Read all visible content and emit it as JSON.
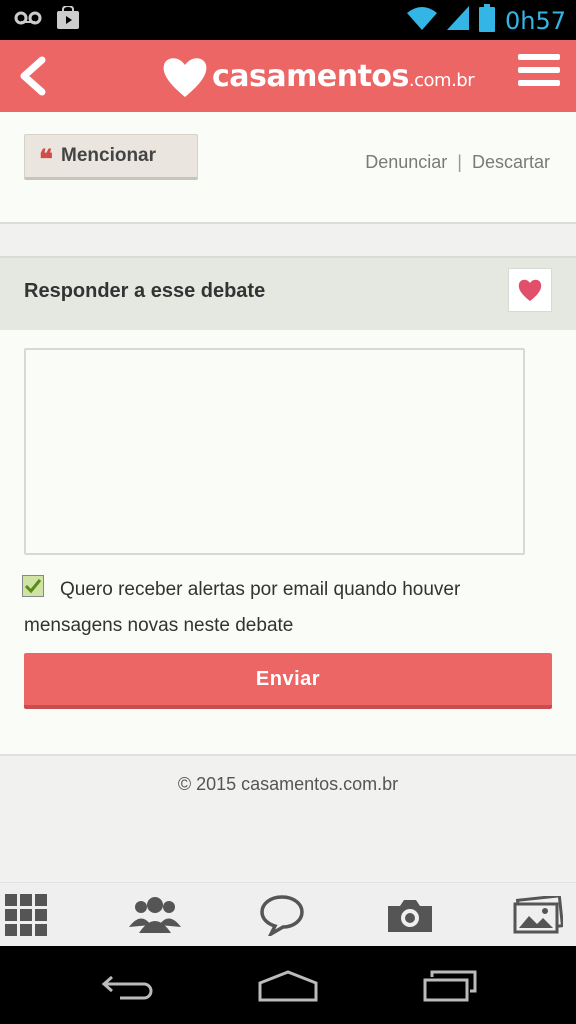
{
  "status_bar": {
    "time": "0h57"
  },
  "header": {
    "logo_text": "casamentos",
    "logo_suffix": ".com.br"
  },
  "actions": {
    "mention_label": "Mencionar",
    "report_label": "Denunciar",
    "separator": "|",
    "discard_label": "Descartar"
  },
  "respond": {
    "title": "Responder a esse debate"
  },
  "form": {
    "message_value": "",
    "alert_checked": true,
    "alert_label": "Quero receber alertas por email quando houver mensagens novas neste debate",
    "send_label": "Enviar"
  },
  "footer": {
    "copyright": "© 2015 casamentos.com.br"
  },
  "icons": {
    "status_left": [
      "voicemail-icon",
      "play-store-icon"
    ],
    "status_right": [
      "wifi-icon",
      "signal-icon",
      "battery-icon"
    ],
    "bottom_nav": [
      "grid-icon",
      "community-icon",
      "chat-bubble-icon",
      "camera-icon",
      "photos-icon"
    ],
    "system_nav": [
      "back-icon",
      "home-icon",
      "recent-apps-icon"
    ]
  },
  "colors": {
    "brand": "#ec6665",
    "status_accent": "#33b5e5",
    "checkbox": "#cfe3a3"
  }
}
